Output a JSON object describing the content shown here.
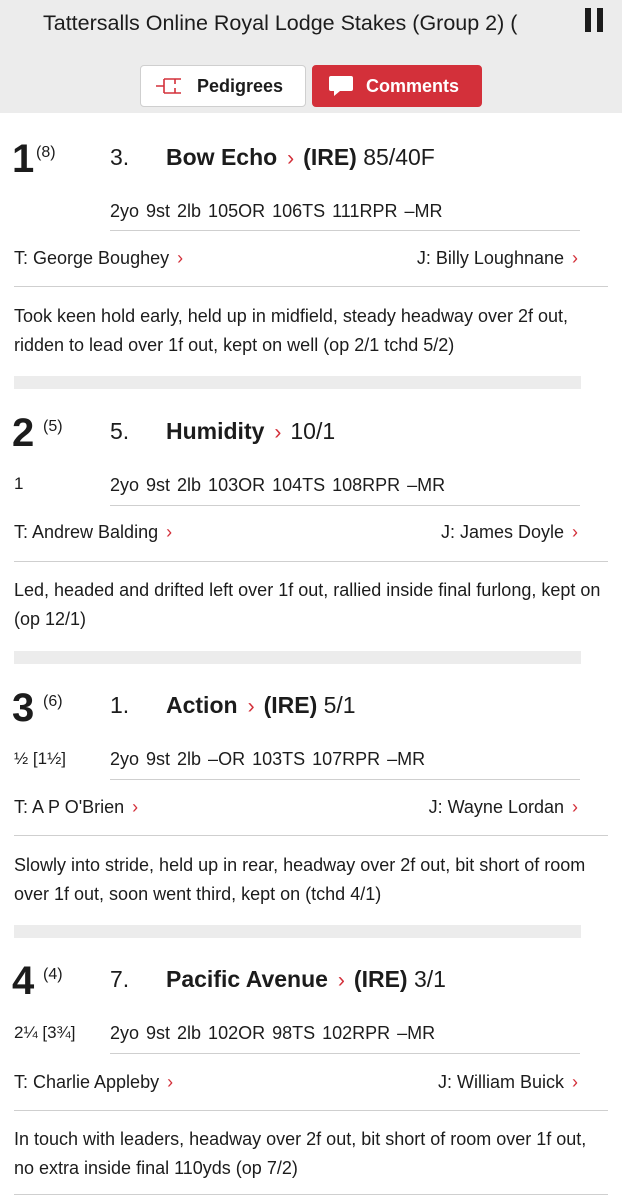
{
  "header": {
    "race_title": "Tattersalls Online Royal Lodge Stakes (Group 2) (",
    "pedigrees_label": "Pedigrees",
    "comments_label": "Comments"
  },
  "colors": {
    "accent": "#d3303a",
    "bar_bg": "#ececec",
    "rule": "#cfcfcf"
  },
  "runners": [
    {
      "position": "1",
      "draw": "(8)",
      "saddle": "3.",
      "horse": "Bow Echo",
      "country": "(IRE)",
      "odds": "85/40F",
      "distance": "",
      "stats": "2yo  9st  2lb  105OR  106TS  111RPR  –MR",
      "trainer": "T: George Boughey",
      "jockey": "J: Billy Loughnane",
      "comment": "Took keen hold early, held up in midfield, steady headway over 2f out, ridden to lead over 1f out, kept on well (op 2/1 tchd 5/2)"
    },
    {
      "position": "2",
      "draw": "(5)",
      "saddle": "5.",
      "horse": "Humidity",
      "country": "",
      "odds": "10/1",
      "distance": "1",
      "stats": "2yo  9st  2lb  103OR  104TS  108RPR  –MR",
      "trainer": "T: Andrew Balding",
      "jockey": "J: James Doyle",
      "comment": "Led, headed and drifted left over 1f out, rallied inside final furlong, kept on (op 12/1)"
    },
    {
      "position": "3",
      "draw": "(6)",
      "saddle": "1.",
      "horse": "Action",
      "country": "(IRE)",
      "odds": "5/1",
      "distance": "½ [1½]",
      "stats": "2yo  9st  2lb  –OR  103TS  107RPR  –MR",
      "trainer": "T: A P O'Brien",
      "jockey": "J: Wayne Lordan",
      "comment": "Slowly into stride, held up in rear, headway over 2f out, bit short of room over 1f out, soon went third, kept on (tchd 4/1)"
    },
    {
      "position": "4",
      "draw": "(4)",
      "saddle": "7.",
      "horse": "Pacific Avenue",
      "country": "(IRE)",
      "odds": "3/1",
      "distance": "2¼ [3¾]",
      "stats": "2yo  9st  2lb  102OR  98TS  102RPR  –MR",
      "trainer": "T: Charlie Appleby",
      "jockey": "J: William Buick",
      "comment": "In touch with leaders, headway over 2f out, bit short of room over 1f out, no extra inside final 110yds (op 7/2)"
    }
  ],
  "chevron": "›"
}
